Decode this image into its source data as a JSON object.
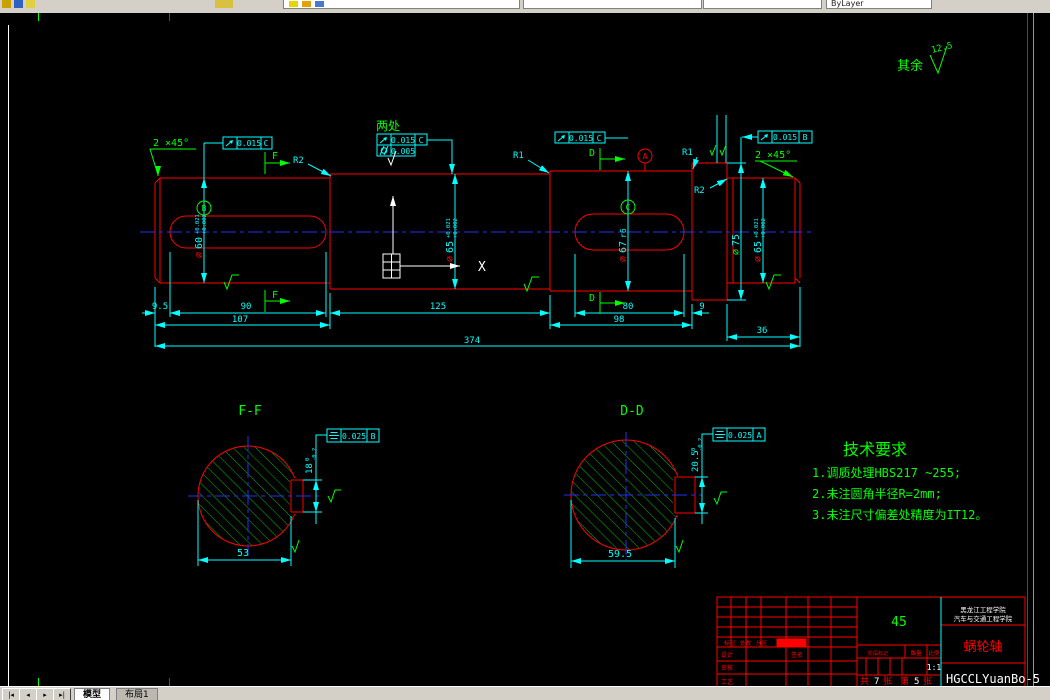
{
  "app": {
    "toolbar": {
      "bylayer": "ByLayer"
    },
    "tabs": {
      "nav_first": "|◂",
      "nav_prev": "◂",
      "nav_next": "▸",
      "nav_last": "▸|",
      "model": "模型",
      "layout1": "布局1"
    }
  },
  "colors": {
    "background": "#000000",
    "outline": "#ff0000",
    "dimensions": "#00ffff",
    "annotations": "#00ff00",
    "centerline": "#2233ee",
    "ui_chrome": "#d4d0c8"
  },
  "notes": {
    "surface_prefix": "其余",
    "surface_value": "12.5",
    "two_places": "两处",
    "chamfer": "2 ×45°"
  },
  "dims": {
    "len_9_5": "9.5",
    "len_90": "90",
    "len_107": "107",
    "len_125": "125",
    "len_80": "80",
    "len_9": "9",
    "len_98": "98",
    "len_36": "36",
    "len_374": "374",
    "dia_60": {
      "prefix": "⌀",
      "main": "60",
      "sup": "+0.021",
      "sub": "+0.002"
    },
    "dia_65_mid": {
      "prefix": "⌀",
      "main": "65",
      "sup": "+0.021",
      "sub": "+0.002"
    },
    "dia_67": {
      "prefix": "⌀",
      "main": "67",
      "fit": "r6"
    },
    "dia_75": {
      "prefix": "⌀",
      "main": "75"
    },
    "dia_65_right": {
      "prefix": "⌀",
      "main": "65",
      "sup": "+0.021",
      "sub": "+0.002"
    },
    "r1": "R1",
    "r2": "R2",
    "ff_width": "53",
    "ff_key": {
      "main": "18",
      "sup": "0",
      "sub": "-0.2"
    },
    "dd_width": "59.5",
    "dd_key": {
      "main": "20.5",
      "sup": "0",
      "sub": "-0.2"
    }
  },
  "fcf": {
    "left": {
      "symbol": "circular-runout",
      "tol": "0.015",
      "datum": "C"
    },
    "mid_top": {
      "symbol": "circular-runout",
      "tol": "0.015",
      "datum": "C"
    },
    "mid_bot": {
      "symbol": "cylindricity",
      "tol": "0.005"
    },
    "right": {
      "symbol": "circular-runout",
      "tol": "0.015",
      "datum": "C"
    },
    "end": {
      "symbol": "circular-runout",
      "tol": "0.015",
      "datum": "B"
    },
    "ff": {
      "symbol": "symmetry",
      "tol": "0.025",
      "datum": "B"
    },
    "dd": {
      "symbol": "symmetry",
      "tol": "0.025",
      "datum": "A"
    }
  },
  "sections": {
    "f": "F",
    "d": "D",
    "ff_label": "F-F",
    "dd_label": "D-D"
  },
  "datums": {
    "a": "A",
    "b": "B",
    "c": "C"
  },
  "ucs": {
    "x_label": "X"
  },
  "tech": {
    "title": "技术要求",
    "line1": "1.调质处理HBS217 ~255;",
    "line2": "2.未注圆角半径R=2mm;",
    "line3": "3.未注尺寸偏差处精度为IT12。"
  },
  "titleblock": {
    "material": "45",
    "school_line1": "黑龙江工程学院",
    "school_line2": "汽车与交通工程学院",
    "part_name": "蜗轮轴",
    "code": "HGCCLYuanBo-5",
    "scale": "1:1",
    "labels": {
      "biaoji": "标记",
      "chushu": "处数",
      "fenqu": "分区",
      "sheji": "设计",
      "qianming": "签名",
      "shenhe": "审核",
      "gongyi": "工艺",
      "jieduan": "阶段标记",
      "shuliang": "数量",
      "bili": "比例"
    },
    "sheet": {
      "gong": "共",
      "total": "7",
      "zhang1": "张",
      "di": "第",
      "num": "5",
      "zhang2": "张"
    }
  }
}
